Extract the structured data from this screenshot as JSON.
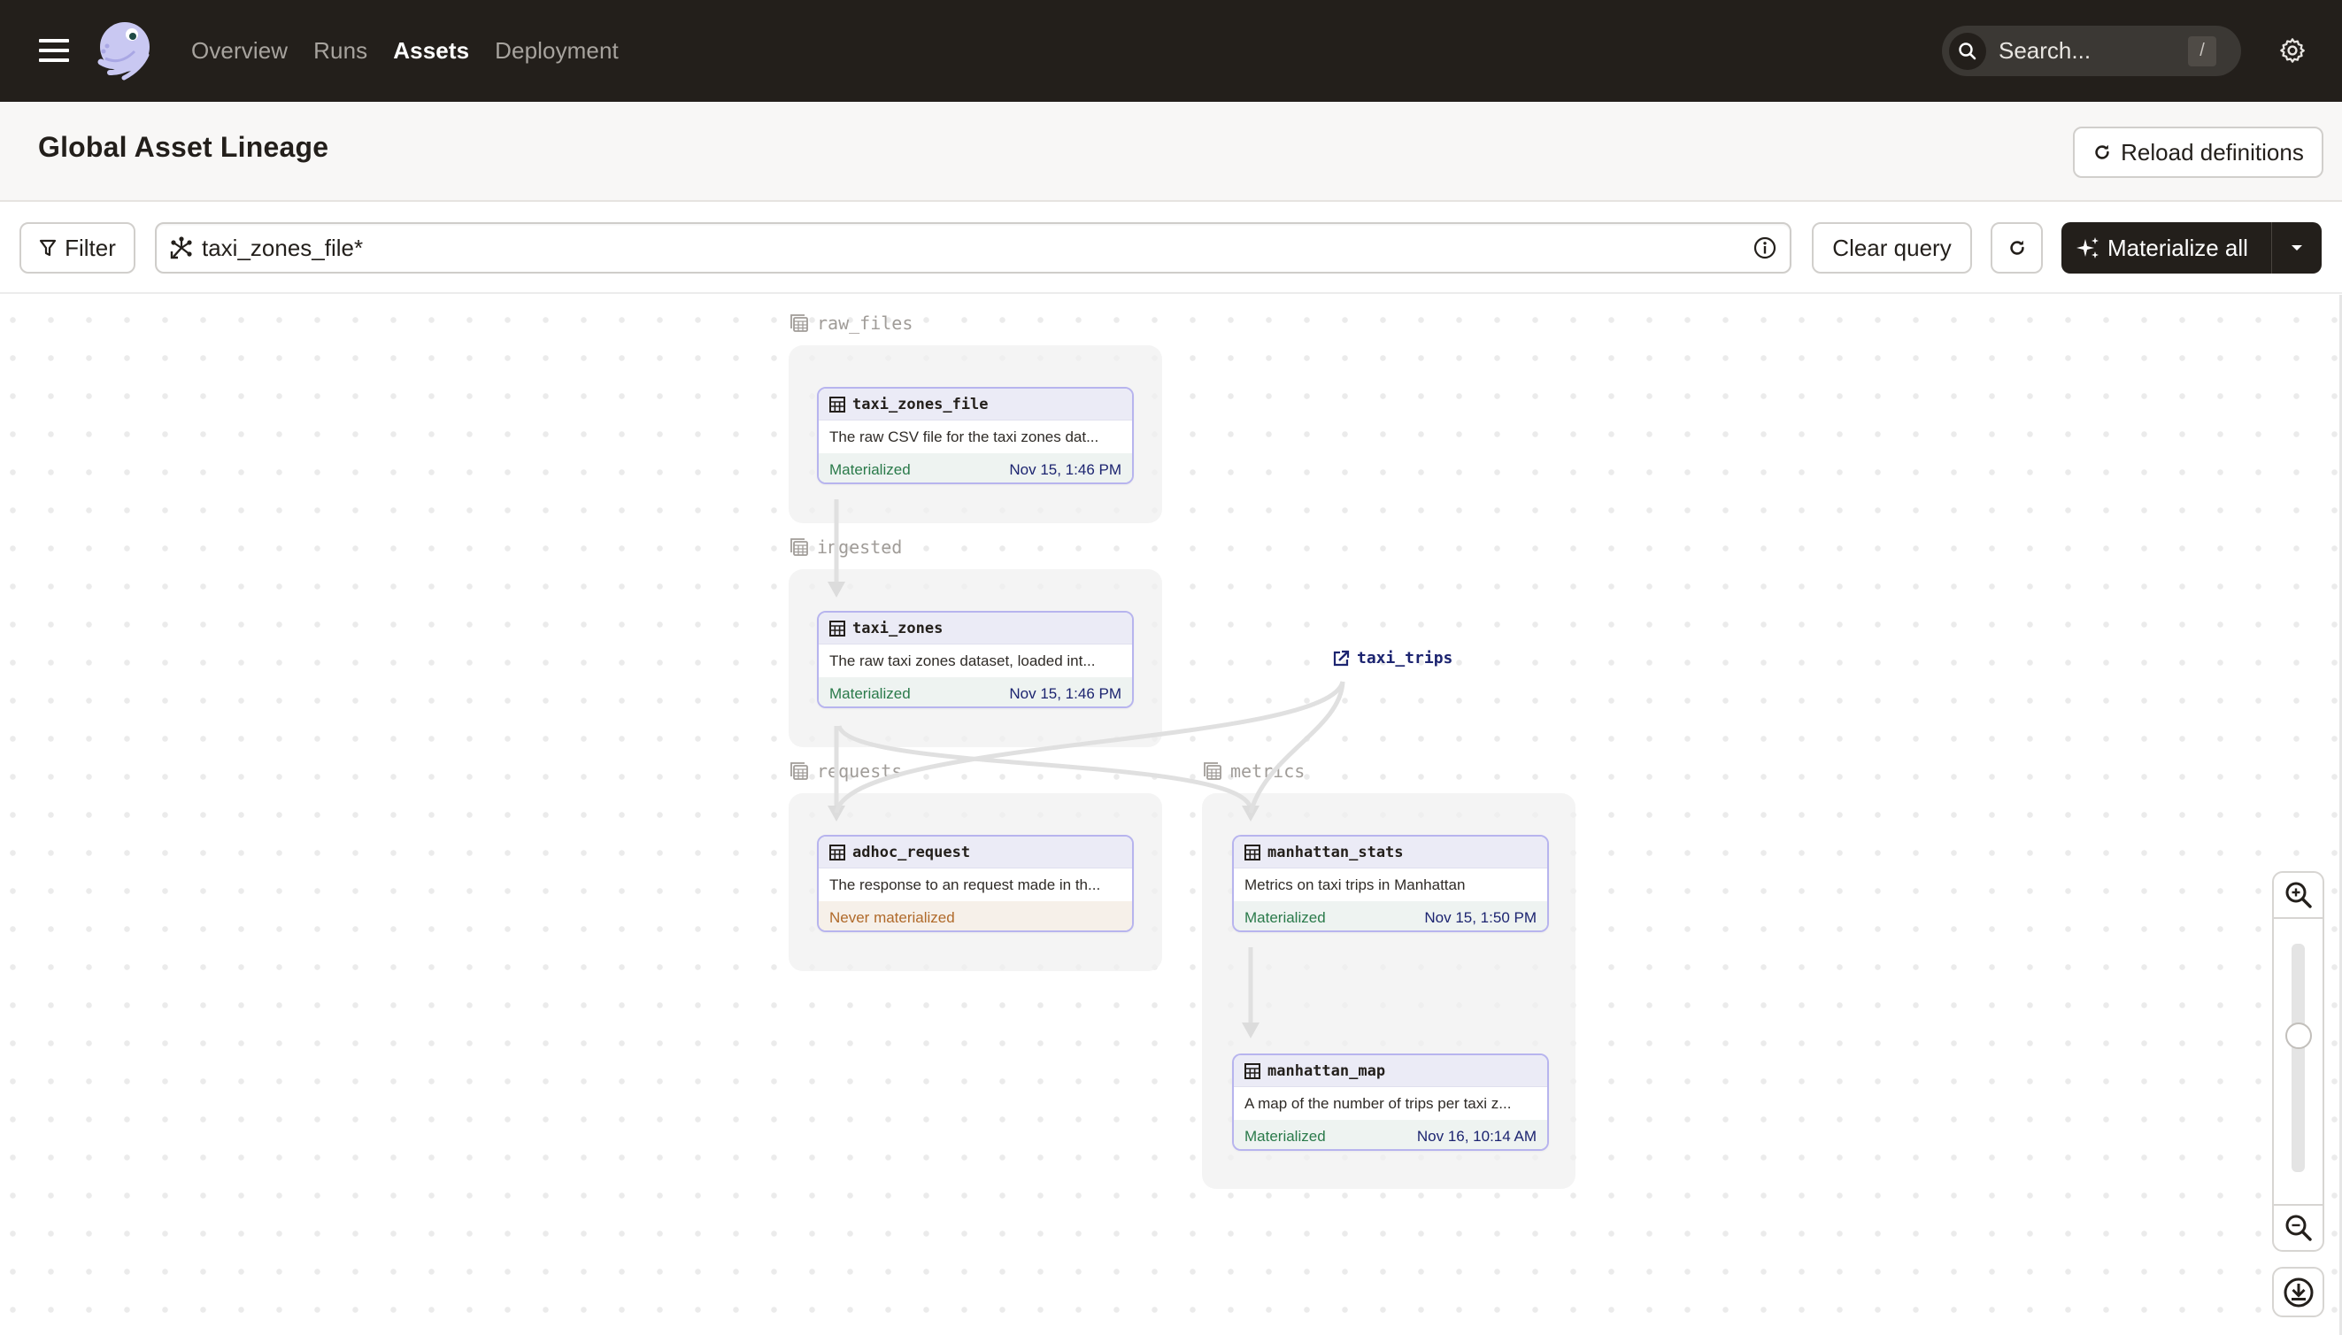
{
  "header": {
    "nav": [
      {
        "label": "Overview",
        "active": false
      },
      {
        "label": "Runs",
        "active": false
      },
      {
        "label": "Assets",
        "active": true
      },
      {
        "label": "Deployment",
        "active": false
      }
    ],
    "search": {
      "placeholder": "Search...",
      "shortcut": "/"
    },
    "icons": {
      "menu": "hamburger-icon",
      "logo": "dagster-octopus-logo",
      "search": "search-icon",
      "settings": "gear-icon"
    }
  },
  "titlebar": {
    "title": "Global Asset Lineage",
    "reload_label": "Reload definitions"
  },
  "toolbar": {
    "filter_label": "Filter",
    "query_value": "taxi_zones_file*",
    "clear_label": "Clear query",
    "materialize_label": "Materialize all"
  },
  "graph": {
    "groups": [
      {
        "id": "raw_files",
        "label": "raw_files"
      },
      {
        "id": "ingested",
        "label": "ingested"
      },
      {
        "id": "requests",
        "label": "requests"
      },
      {
        "id": "metrics",
        "label": "metrics"
      }
    ],
    "assets": [
      {
        "name": "taxi_zones_file",
        "group": "raw_files",
        "description": "The raw CSV file for the taxi zones dat...",
        "status": "Materialized",
        "time": "Nov 15, 1:46 PM"
      },
      {
        "name": "taxi_zones",
        "group": "ingested",
        "description": "The raw taxi zones dataset, loaded int...",
        "status": "Materialized",
        "time": "Nov 15, 1:46 PM"
      },
      {
        "name": "adhoc_request",
        "group": "requests",
        "description": "The response to an request made in th...",
        "status": "Never materialized",
        "time": ""
      },
      {
        "name": "manhattan_stats",
        "group": "metrics",
        "description": "Metrics on taxi trips in Manhattan",
        "status": "Materialized",
        "time": "Nov 15, 1:50 PM"
      },
      {
        "name": "manhattan_map",
        "group": "metrics",
        "description": "A map of the number of trips per taxi z...",
        "status": "Materialized",
        "time": "Nov 16, 10:14 AM"
      }
    ],
    "external_assets": [
      {
        "name": "taxi_trips"
      }
    ],
    "edges": [
      {
        "from": "taxi_zones_file",
        "to": "taxi_zones"
      },
      {
        "from": "taxi_zones",
        "to": "adhoc_request"
      },
      {
        "from": "taxi_zones",
        "to": "manhattan_stats"
      },
      {
        "from": "taxi_trips",
        "to": "adhoc_request"
      },
      {
        "from": "taxi_trips",
        "to": "manhattan_stats"
      },
      {
        "from": "manhattan_stats",
        "to": "manhattan_map"
      }
    ]
  },
  "zoom_control": {
    "level_fraction": 0.61
  },
  "colors": {
    "header_bg": "#231f1b",
    "node_border": "#b7b4ee",
    "materialized": "#2a7a4a",
    "never_materialized": "#b06a2a",
    "timestamp": "#1c2470"
  }
}
